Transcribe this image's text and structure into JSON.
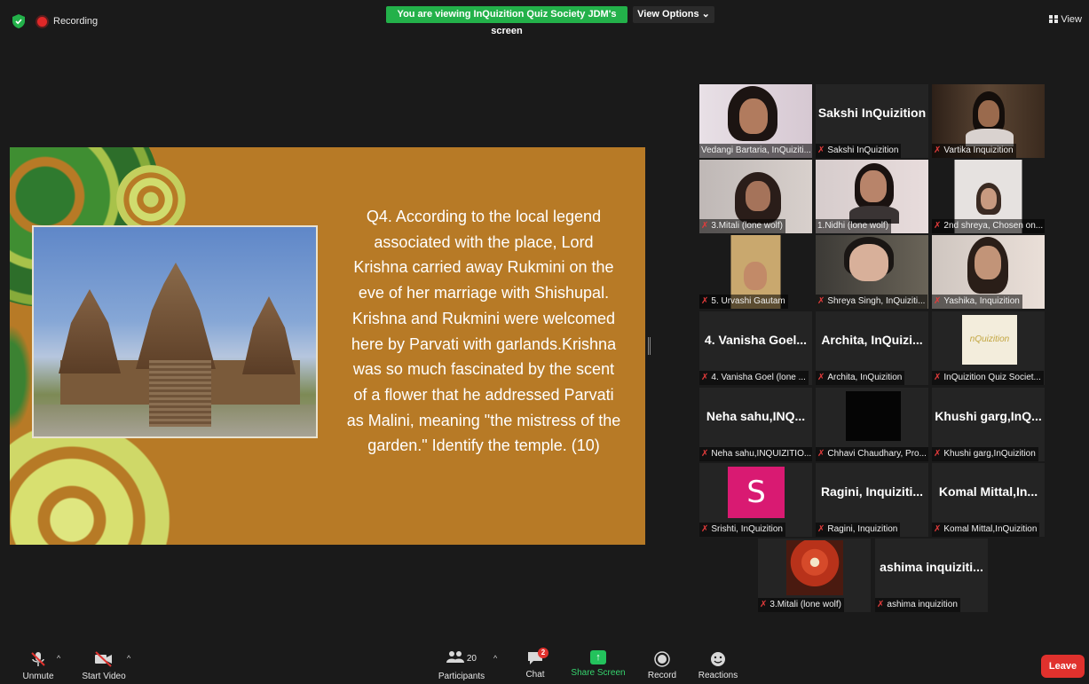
{
  "topbar": {
    "recording_label": "Recording",
    "viewing_banner": "You are viewing InQuizition Quiz Society JDM's screen",
    "view_options": "View Options ⌄",
    "view_label": "View"
  },
  "slide": {
    "question": "Q4. According to the local legend associated with the place, Lord Krishna carried away Rukmini on the eve of her marriage with Shishupal. Krishna and Rukmini were welcomed here by Parvati with garlands.Krishna was so much fascinated by the scent of a flower that he addressed Parvati as Malini, meaning \"the mistress of the garden.\" Identify the temple. (10)"
  },
  "participants": [
    {
      "big": "",
      "label": "Vedangi Bartaria, InQuiziti...",
      "muted": false
    },
    {
      "big": "Sakshi InQuizition",
      "label": "Sakshi InQuizition",
      "muted": true
    },
    {
      "big": "",
      "label": "Vartika Inquizition",
      "muted": true
    },
    {
      "big": "",
      "label": "3.Mitali (lone wolf)",
      "muted": true
    },
    {
      "big": "",
      "label": "1.Nidhi (lone wolf)",
      "muted": false
    },
    {
      "big": "",
      "label": "2nd shreya, Chosen on...",
      "muted": true
    },
    {
      "big": "",
      "label": "5. Urvashi Gautam",
      "muted": true
    },
    {
      "big": "",
      "label": "Shreya Singh, InQuiziti...",
      "muted": true
    },
    {
      "big": "",
      "label": "Yashika, Inquizition",
      "muted": true
    },
    {
      "big": "4. Vanisha Goel...",
      "label": "4. Vanisha Goel (lone ...",
      "muted": true
    },
    {
      "big": "Archita, InQuizi...",
      "label": "Archita, InQuizition",
      "muted": true
    },
    {
      "big": "",
      "label": "InQuizition Quiz Societ...",
      "muted": true
    },
    {
      "big": "Neha sahu,INQ...",
      "label": "Neha sahu,INQUIZITIO...",
      "muted": true
    },
    {
      "big": "",
      "label": "Chhavi Chaudhary, Pro...",
      "muted": true
    },
    {
      "big": "Khushi garg,InQ...",
      "label": "Khushi garg,InQuizition",
      "muted": true
    },
    {
      "big": "",
      "label": "Srishti, InQuizition",
      "muted": true
    },
    {
      "big": "Ragini, Inquiziti...",
      "label": "Ragini, Inquizition",
      "muted": true
    },
    {
      "big": "Komal Mittal,In...",
      "label": "Komal Mittal,InQuizition",
      "muted": true
    },
    {
      "big": "",
      "label": "3.Mitali (lone wolf)",
      "muted": true
    },
    {
      "big": "ashima inquiziti...",
      "label": "ashima inquizition",
      "muted": true
    }
  ],
  "avatar_letter": "S",
  "logo_text": "nQuizition",
  "toolbar": {
    "unmute": "Unmute",
    "start_video": "Start Video",
    "participants": "Participants",
    "participants_count": "20",
    "chat": "Chat",
    "chat_badge": "2",
    "share_screen": "Share Screen",
    "record": "Record",
    "reactions": "Reactions",
    "leave": "Leave"
  },
  "colors": {
    "banner_green": "#23b14a",
    "slide_bg": "#b77a26",
    "leave_red": "#e0312d",
    "active_speaker": "#d5f07a",
    "mute_red": "#e23b3b"
  }
}
